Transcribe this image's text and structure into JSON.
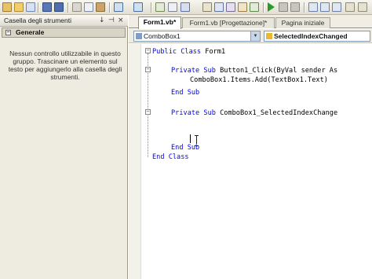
{
  "toolbox": {
    "title": "Casella degli strumenti",
    "pin_glyph": "↓",
    "pin_glyph2": "⊣",
    "close_glyph": "×",
    "group_label": "Generale",
    "group_toggle_glyph": "−",
    "empty_message": "Nessun controllo utilizzabile in questo gruppo. Trascinare un elemento sul testo per aggiungerlo alla casella degli strumenti."
  },
  "tabs": [
    {
      "label": "Form1.vb*",
      "active": true
    },
    {
      "label": "Form1.vb [Progettazione]*",
      "active": false
    },
    {
      "label": "Pagina iniziale",
      "active": false
    }
  ],
  "navbar": {
    "object_combo": "ComboBox1",
    "event_combo": "SelectedIndexChanged"
  },
  "code": {
    "line1": {
      "kw": "Public Class",
      "rest": " Form1"
    },
    "line2": {
      "kw": "Private Sub",
      "rest": " Button1_Click(ByVal sender As"
    },
    "line3": {
      "text": "ComboBox1.Items.Add(TextBox1.Text)"
    },
    "line4": {
      "kw": "End Sub"
    },
    "line5": {
      "kw": "Private Sub",
      "rest": " ComboBox1_SelectedIndexChange"
    },
    "line6": {
      "kw": "End Sub"
    },
    "line7": {
      "kw": "End Class"
    }
  },
  "colors": {
    "keyword": "#0000ff",
    "toolbox_bg": "#eeece0",
    "editor_bg": "#ffffff"
  },
  "icons": {
    "toolbar": [
      "new-project-icon",
      "open-icon",
      "add-item-icon",
      "save-icon",
      "save-all-icon",
      "cut-icon",
      "copy-icon",
      "paste-icon",
      "undo-icon",
      "redo-icon",
      "navigate-icon",
      "start-debug-icon",
      "pause-icon",
      "stop-icon"
    ]
  }
}
